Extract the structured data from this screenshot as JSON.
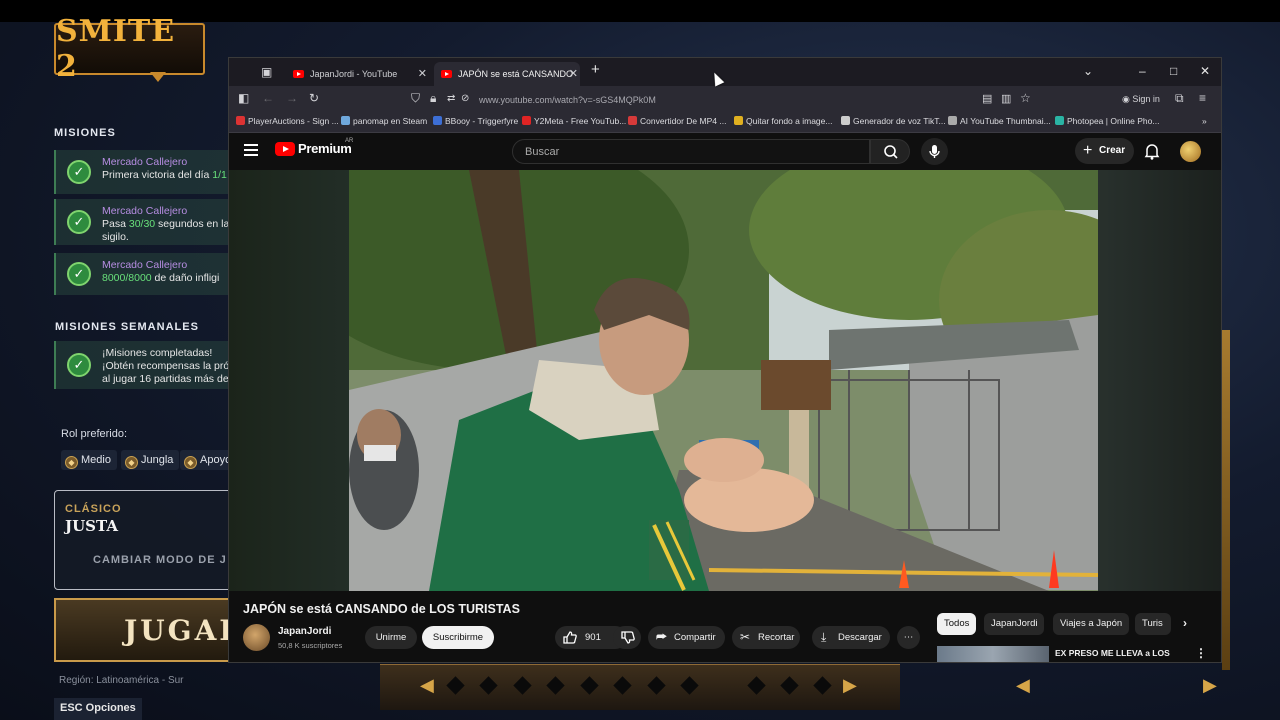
{
  "game": {
    "logo_text": "SMITE 2",
    "misiones_title": "MISIONES",
    "missions": [
      {
        "title": "Mercado Callejero",
        "desc_pre": "Primera victoria del día ",
        "desc_hl": "1/1",
        "desc_post": ""
      },
      {
        "title": "Mercado Callejero",
        "desc_pre": "Pasa ",
        "desc_hl": "30/30",
        "desc_post": " segundos en la",
        "desc2": "sigilo."
      },
      {
        "title": "Mercado Callejero",
        "desc_pre": "",
        "desc_hl": "8000/8000",
        "desc_post": " de daño infligi"
      }
    ],
    "weekly_title": "MISIONES SEMANALES",
    "weekly": {
      "line1": "¡Misiones completadas!",
      "line2": "¡Obtén recompensas la pró",
      "line3": "al jugar 16 partidas más de"
    },
    "rol_label": "Rol preferido:",
    "roles": [
      "Medio",
      "Jungla",
      "Apoyo"
    ],
    "mode_sub": "CLÁSICO",
    "mode_main": "JUSTA",
    "mode_change": "CAMBIAR MODO DE J",
    "play_label": "JUGAR",
    "region": "Región: Latinoamérica - Sur",
    "esc_label": "ESC  Opciones"
  },
  "browser": {
    "tabs": [
      {
        "label": "JapanJordi - YouTube",
        "active": false
      },
      {
        "label": "JAPÓN se está CANSANDO",
        "active": true
      }
    ],
    "url": "www.youtube.com/watch?v=-sGS4MQPk0M",
    "sign_in": "Sign in",
    "bookmarks": [
      {
        "label": "PlayerAuctions - Sign ...",
        "color": "#d33"
      },
      {
        "label": "panomap en Steam",
        "color": "#6fa8dc"
      },
      {
        "label": "BBooy - Triggerfyre",
        "color": "#3d6fd6"
      },
      {
        "label": "Y2Meta - Free YouTub...",
        "color": "#e02424"
      },
      {
        "label": "Convertidor De MP4 ...",
        "color": "#d63a3a"
      },
      {
        "label": "Quitar fondo a image...",
        "color": "#e0b020"
      },
      {
        "label": "Generador de voz TikT...",
        "color": "#cccccc"
      },
      {
        "label": "AI YouTube Thumbnai...",
        "color": "#aaaaaa"
      },
      {
        "label": "Photopea | Online Pho...",
        "color": "#2ab4a4"
      }
    ]
  },
  "youtube": {
    "brand": "Premium",
    "region_code": "AR",
    "search_placeholder": "Buscar",
    "create_label": "Crear",
    "video_title": "JAPÓN se está CANSANDO de LOS TURISTAS",
    "channel_name": "JapanJordi",
    "channel_subs": "50,8 K suscriptores",
    "join_label": "Unirme",
    "subscribe_label": "Suscribirme",
    "likes": "901",
    "share_label": "Compartir",
    "clip_label": "Recortar",
    "download_label": "Descargar",
    "chips": [
      "Todos",
      "JapanJordi",
      "Viajes a Japón",
      "Turis"
    ],
    "rec_title": "EX PRESO ME LLEVA a LOS BARRIOS SIN LEY de ROSARI"
  },
  "colors": {
    "yt_red": "#ff0000",
    "mission_purple": "#b68de2",
    "mission_green": "#68e07a",
    "gold": "#c8892c"
  }
}
